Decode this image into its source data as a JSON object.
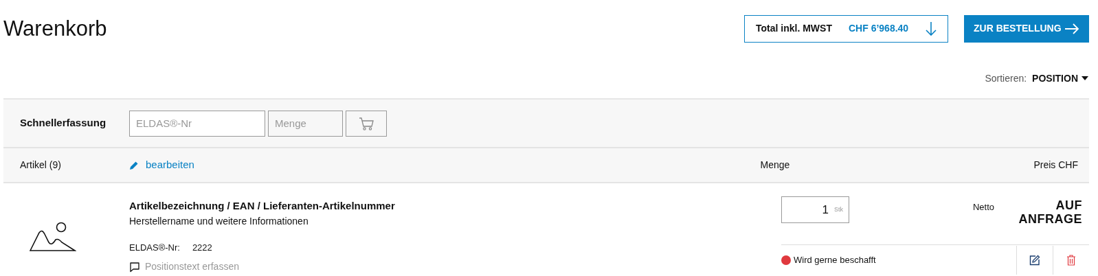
{
  "page": {
    "title": "Warenkorb"
  },
  "total": {
    "label": "Total inkl. MWST",
    "amount": "CHF 6’968.40"
  },
  "order_button": {
    "label": "ZUR BESTELLUNG"
  },
  "sort": {
    "label": "Sortieren:",
    "value": "POSITION"
  },
  "quick_entry": {
    "label": "Schnellerfassung",
    "article_field": {
      "placeholder": "ELDAS®-Nr"
    },
    "quantity_field": {
      "placeholder": "Menge"
    }
  },
  "list_header": {
    "count_label": "Artikel (9)",
    "edit_link": "bearbeiten",
    "quantity_heading": "Menge",
    "price_heading": "Preis CHF"
  },
  "items": [
    {
      "title": "Artikelbezeichnung / EAN / Lieferanten-Artikelnummer",
      "subtitle": "Herstellername und weitere Informationen",
      "number_label": "ELDAS®-Nr:",
      "number": "2222",
      "note_link": "Positionstext erfassen",
      "quantity": "1",
      "unit": "Stk",
      "price_label": "Netto",
      "price": "AUF ANFRAGE",
      "status": {
        "text": "Wird gerne beschafft",
        "color": "#e0393e"
      }
    }
  ]
}
